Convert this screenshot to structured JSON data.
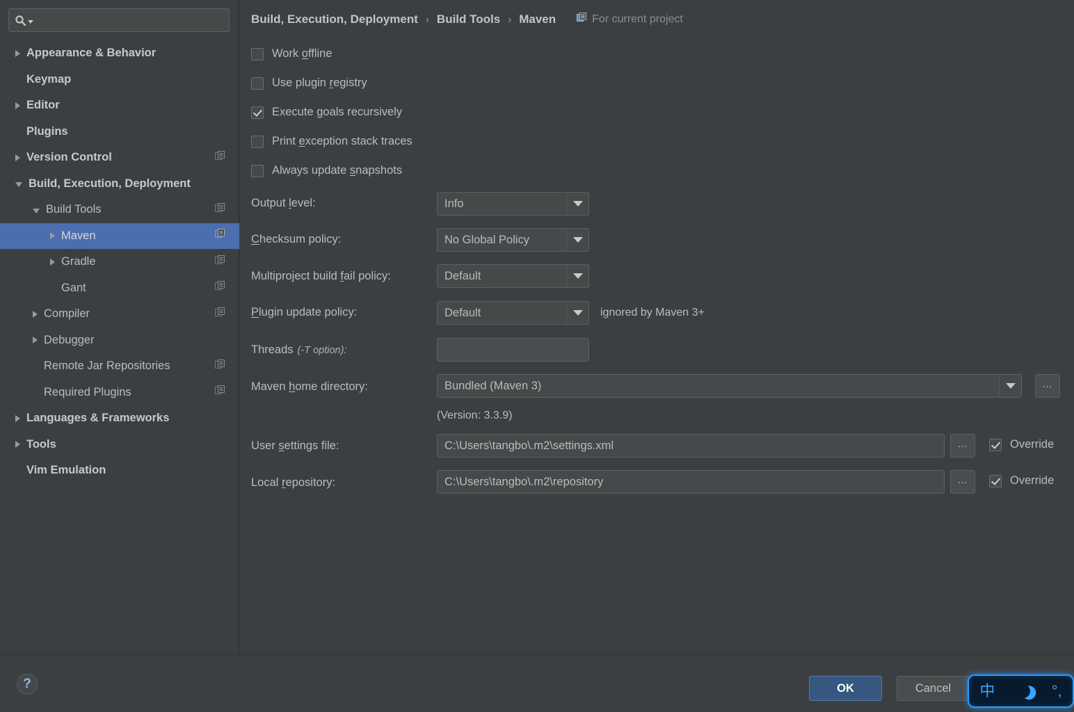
{
  "search": {
    "placeholder": "",
    "value": "",
    "icon": "search-icon"
  },
  "sidebar": {
    "items": [
      {
        "label": "Appearance & Behavior",
        "indent": 0,
        "twisty": "closed",
        "bold": true,
        "badge": false,
        "selected": false
      },
      {
        "label": "Keymap",
        "indent": 0,
        "twisty": "none",
        "bold": true,
        "badge": false,
        "selected": false
      },
      {
        "label": "Editor",
        "indent": 0,
        "twisty": "closed",
        "bold": true,
        "badge": false,
        "selected": false
      },
      {
        "label": "Plugins",
        "indent": 0,
        "twisty": "none",
        "bold": true,
        "badge": false,
        "selected": false
      },
      {
        "label": "Version Control",
        "indent": 0,
        "twisty": "closed",
        "bold": true,
        "badge": true,
        "selected": false
      },
      {
        "label": "Build, Execution, Deployment",
        "indent": 0,
        "twisty": "open",
        "bold": true,
        "badge": false,
        "selected": false
      },
      {
        "label": "Build Tools",
        "indent": 1,
        "twisty": "open",
        "bold": false,
        "badge": true,
        "selected": false
      },
      {
        "label": "Maven",
        "indent": 2,
        "twisty": "closed",
        "bold": false,
        "badge": true,
        "selected": true
      },
      {
        "label": "Gradle",
        "indent": 2,
        "twisty": "closed",
        "bold": false,
        "badge": true,
        "selected": false
      },
      {
        "label": "Gant",
        "indent": 2,
        "twisty": "none",
        "bold": false,
        "badge": true,
        "selected": false
      },
      {
        "label": "Compiler",
        "indent": 1,
        "twisty": "closed",
        "bold": false,
        "badge": true,
        "selected": false
      },
      {
        "label": "Debugger",
        "indent": 1,
        "twisty": "closed",
        "bold": false,
        "badge": false,
        "selected": false
      },
      {
        "label": "Remote Jar Repositories",
        "indent": 1,
        "twisty": "none",
        "bold": false,
        "badge": true,
        "selected": false
      },
      {
        "label": "Required Plugins",
        "indent": 1,
        "twisty": "none",
        "bold": false,
        "badge": true,
        "selected": false
      },
      {
        "label": "Languages & Frameworks",
        "indent": 0,
        "twisty": "closed",
        "bold": true,
        "badge": false,
        "selected": false
      },
      {
        "label": "Tools",
        "indent": 0,
        "twisty": "closed",
        "bold": true,
        "badge": false,
        "selected": false
      },
      {
        "label": "Vim Emulation",
        "indent": 0,
        "twisty": "none",
        "bold": true,
        "badge": false,
        "selected": false
      }
    ]
  },
  "breadcrumb": {
    "crumb1": "Build, Execution, Deployment",
    "crumb2": "Build Tools",
    "crumb3": "Maven",
    "separator": "›",
    "scope_note": "For current project",
    "scope_icon": "project-scope-icon"
  },
  "checkboxes": [
    {
      "pre": "Work ",
      "mnemonic": "o",
      "post": "ffline",
      "checked": false
    },
    {
      "pre": "Use plugin ",
      "mnemonic": "r",
      "post": "egistry",
      "checked": false
    },
    {
      "pre": "Execute ",
      "mnemonic": "g",
      "post": "oals recursively",
      "checked": true
    },
    {
      "pre": "Print ",
      "mnemonic": "e",
      "post": "xception stack traces",
      "checked": false
    },
    {
      "pre": "Always update ",
      "mnemonic": "s",
      "post": "napshots",
      "checked": false
    }
  ],
  "fields": {
    "output_level": {
      "pre": "Output ",
      "mnemonic": "l",
      "post": "evel:",
      "value": "Info"
    },
    "checksum_policy": {
      "pre": "",
      "mnemonic": "C",
      "post": "hecksum policy:",
      "value": "No Global Policy"
    },
    "multiproject": {
      "pre": "Multiproject build ",
      "mnemonic": "f",
      "post": "ail policy:",
      "value": "Default"
    },
    "plugin_update": {
      "pre": "",
      "mnemonic": "P",
      "post": "lugin update policy:",
      "value": "Default",
      "note": "ignored by Maven 3+"
    },
    "threads": {
      "pre": "Threads",
      "italic": "(-T option):",
      "value": ""
    },
    "maven_home": {
      "pre": "Maven ",
      "mnemonic": "h",
      "post": "ome directory:",
      "value": "Bundled (Maven 3)",
      "version_note": "(Version: 3.3.9)"
    },
    "user_settings": {
      "pre": "User ",
      "mnemonic": "s",
      "post": "ettings file:",
      "value": "C:\\Users\\tangbo\\.m2\\settings.xml",
      "override_label": "Override",
      "override_checked": true
    },
    "local_repo": {
      "pre": "Local ",
      "mnemonic": "r",
      "post": "epository:",
      "value": "C:\\Users\\tangbo\\.m2\\repository",
      "override_label": "Override",
      "override_checked": true
    }
  },
  "browse_button_label": "…",
  "footer": {
    "help_label": "?",
    "ok_label": "OK",
    "cancel_label": "Cancel"
  },
  "ime": {
    "mode": "中",
    "moon_icon": "moon-icon",
    "punctuation": "°,"
  },
  "colors": {
    "background": "#3c3f41",
    "field_background": "#45494a",
    "selection": "#4b6eaf",
    "text": "#bbbbbb",
    "accent_button": "#365880",
    "ime_accent": "#2e9bff"
  }
}
